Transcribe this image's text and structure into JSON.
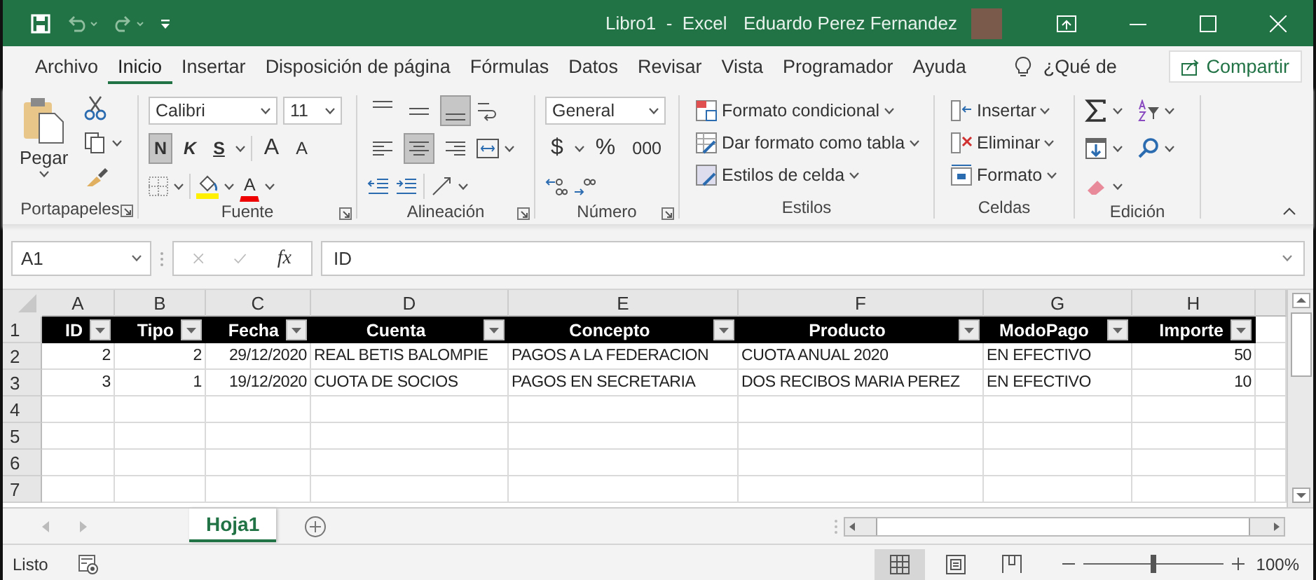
{
  "title_bar": {
    "title": "Libro1  -  Excel",
    "user": "Eduardo Perez Fernandez"
  },
  "menu": {
    "tabs": [
      {
        "label": "Archivo",
        "selected": false
      },
      {
        "label": "Inicio",
        "selected": true
      },
      {
        "label": "Insertar",
        "selected": false
      },
      {
        "label": "Disposición de página",
        "selected": false
      },
      {
        "label": "Fórmulas",
        "selected": false
      },
      {
        "label": "Datos",
        "selected": false
      },
      {
        "label": "Revisar",
        "selected": false
      },
      {
        "label": "Vista",
        "selected": false
      },
      {
        "label": "Programador",
        "selected": false
      },
      {
        "label": "Ayuda",
        "selected": false
      }
    ],
    "tell_me": "¿Qué de",
    "share": "Compartir"
  },
  "ribbon": {
    "clipboard": {
      "label": "Portapapeles",
      "paste": "Pegar"
    },
    "font": {
      "label": "Fuente",
      "font_name": "Calibri",
      "font_size": "11",
      "style_buttons": [
        {
          "label": "N",
          "pressed": true
        },
        {
          "label": "K",
          "pressed": false
        },
        {
          "label": "S",
          "pressed": false
        }
      ],
      "grow": "A",
      "shrink": "A",
      "color_button": "A"
    },
    "alignment": {
      "label": "Alineación",
      "vertical": [
        {
          "pressed": false
        },
        {
          "pressed": false
        },
        {
          "pressed": true
        }
      ],
      "horizontal": [
        {
          "pressed": false
        },
        {
          "pressed": true
        },
        {
          "pressed": false
        }
      ]
    },
    "number": {
      "label": "Número",
      "format": "General",
      "currency": "$",
      "percent": "%",
      "thousands": "000"
    },
    "styles": {
      "label": "Estilos",
      "items": [
        "Formato condicional",
        "Dar formato como tabla",
        "Estilos de celda"
      ]
    },
    "cells": {
      "label": "Celdas",
      "items": [
        "Insertar",
        "Eliminar",
        "Formato"
      ]
    },
    "editing": {
      "label": "Edición"
    }
  },
  "formula_bar": {
    "name_box": "A1",
    "function_label": "fx",
    "value": "ID"
  },
  "sheet": {
    "columns": [
      {
        "letter": "A",
        "header": "ID",
        "kind": "number"
      },
      {
        "letter": "B",
        "header": "Tipo",
        "kind": "number"
      },
      {
        "letter": "C",
        "header": "Fecha",
        "kind": "number"
      },
      {
        "letter": "D",
        "header": "Cuenta",
        "kind": "text"
      },
      {
        "letter": "E",
        "header": "Concepto",
        "kind": "text"
      },
      {
        "letter": "F",
        "header": "Producto",
        "kind": "text"
      },
      {
        "letter": "G",
        "header": "ModoPago",
        "kind": "text"
      },
      {
        "letter": "H",
        "header": "Importe",
        "kind": "number"
      }
    ],
    "header_row": "1",
    "rows": [
      {
        "number": "2",
        "cells": [
          "2",
          "2",
          "29/12/2020",
          "REAL BETIS BALOMPIE",
          "PAGOS A LA FEDERACION",
          "CUOTA ANUAL 2020",
          "EN EFECTIVO",
          "50"
        ]
      },
      {
        "number": "3",
        "cells": [
          "3",
          "1",
          "19/12/2020",
          "CUOTA DE SOCIOS",
          "PAGOS EN SECRETARIA",
          "DOS RECIBOS MARIA PEREZ",
          "EN EFECTIVO",
          "10"
        ]
      },
      {
        "number": "4"
      },
      {
        "number": "5"
      },
      {
        "number": "6"
      },
      {
        "number": "7"
      }
    ]
  },
  "sheet_tabs": [
    {
      "label": "Hoja1",
      "selected": true
    }
  ],
  "status_bar": {
    "status": "Listo",
    "view_buttons": [
      {
        "selected": true
      },
      {
        "selected": false
      },
      {
        "selected": false
      }
    ],
    "zoom_slider": {
      "level": 0.5
    },
    "zoom": "100%"
  }
}
